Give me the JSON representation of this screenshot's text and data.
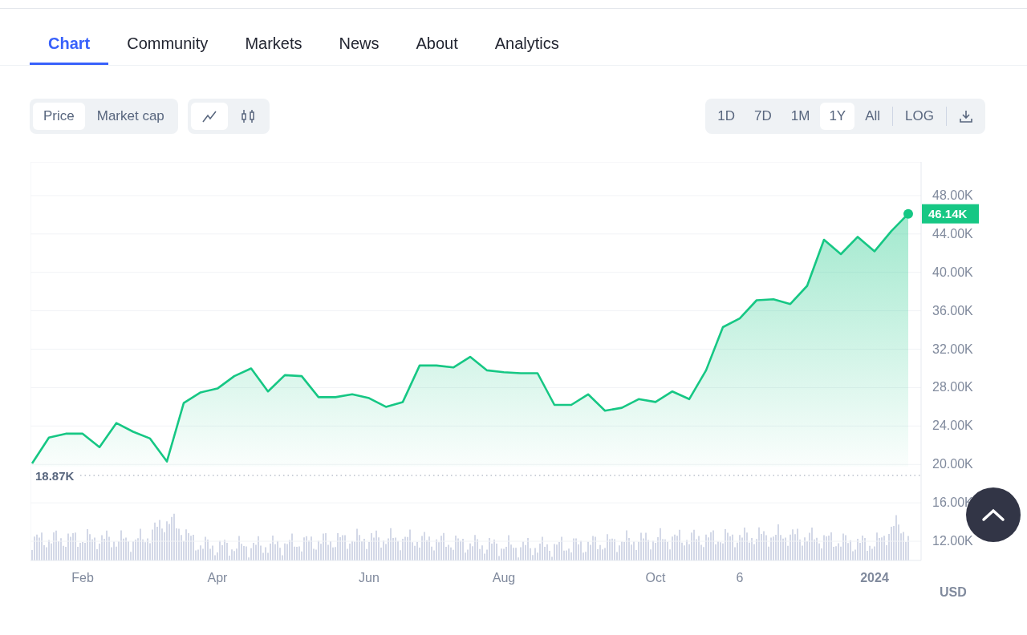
{
  "tabs": [
    {
      "label": "Chart",
      "selected": true
    },
    {
      "label": "Community",
      "selected": false
    },
    {
      "label": "Markets",
      "selected": false
    },
    {
      "label": "News",
      "selected": false
    },
    {
      "label": "About",
      "selected": false
    },
    {
      "label": "Analytics",
      "selected": false
    }
  ],
  "metric_toggle": [
    {
      "label": "Price",
      "selected": true
    },
    {
      "label": "Market cap",
      "selected": false
    }
  ],
  "chart_type_toggle": [
    {
      "kind": "line",
      "selected": true
    },
    {
      "kind": "candles",
      "selected": false
    }
  ],
  "range_toggle": [
    {
      "label": "1D",
      "selected": false
    },
    {
      "label": "7D",
      "selected": false
    },
    {
      "label": "1M",
      "selected": false
    },
    {
      "label": "1Y",
      "selected": true
    },
    {
      "label": "All",
      "selected": false
    }
  ],
  "scale_button": "LOG",
  "chart": {
    "current_price": "46.14K",
    "baseline_price": "18.87K",
    "currency": "USD",
    "chart_data": {
      "type": "area",
      "grid": true,
      "categories": [
        null,
        null,
        null,
        "Feb",
        null,
        null,
        null,
        null,
        null,
        null,
        null,
        "Apr",
        null,
        null,
        null,
        null,
        null,
        null,
        null,
        null,
        "Jun",
        null,
        null,
        null,
        null,
        null,
        null,
        null,
        "Aug",
        null,
        null,
        null,
        null,
        null,
        null,
        null,
        null,
        "Oct",
        null,
        null,
        null,
        null,
        "6",
        null,
        null,
        null,
        null,
        null,
        null,
        null,
        "2024",
        null,
        null
      ],
      "series": [
        {
          "color": "#16c784",
          "values": [
            20.1,
            22.8,
            23.2,
            23.2,
            21.8,
            24.3,
            23.4,
            22.7,
            20.3,
            26.4,
            27.5,
            27.9,
            29.2,
            30.0,
            27.6,
            29.3,
            29.2,
            27.0,
            27.0,
            27.3,
            26.9,
            26.0,
            26.5,
            30.3,
            30.3,
            30.1,
            31.2,
            29.8,
            29.6,
            29.5,
            29.5,
            26.2,
            26.2,
            27.3,
            25.6,
            25.9,
            26.8,
            26.5,
            27.6,
            26.8,
            29.8,
            34.3,
            35.2,
            37.1,
            37.2,
            36.7,
            38.6,
            43.4,
            41.9,
            43.7,
            42.2,
            44.3,
            46.1
          ]
        }
      ],
      "ylim": [
        10,
        51.5
      ],
      "yticks": [
        {
          "value": 12,
          "label": "12.00K"
        },
        {
          "value": 16,
          "label": "16.00K"
        },
        {
          "value": 20,
          "label": "20.00K"
        },
        {
          "value": 24,
          "label": "24.00K"
        },
        {
          "value": 28,
          "label": "28.00K"
        },
        {
          "value": 32,
          "label": "32.00K"
        },
        {
          "value": 36,
          "label": "36.00K"
        },
        {
          "value": 40,
          "label": "40.00K"
        },
        {
          "value": 44,
          "label": "44.00K"
        },
        {
          "value": 48,
          "label": "48.00K"
        }
      ]
    }
  }
}
